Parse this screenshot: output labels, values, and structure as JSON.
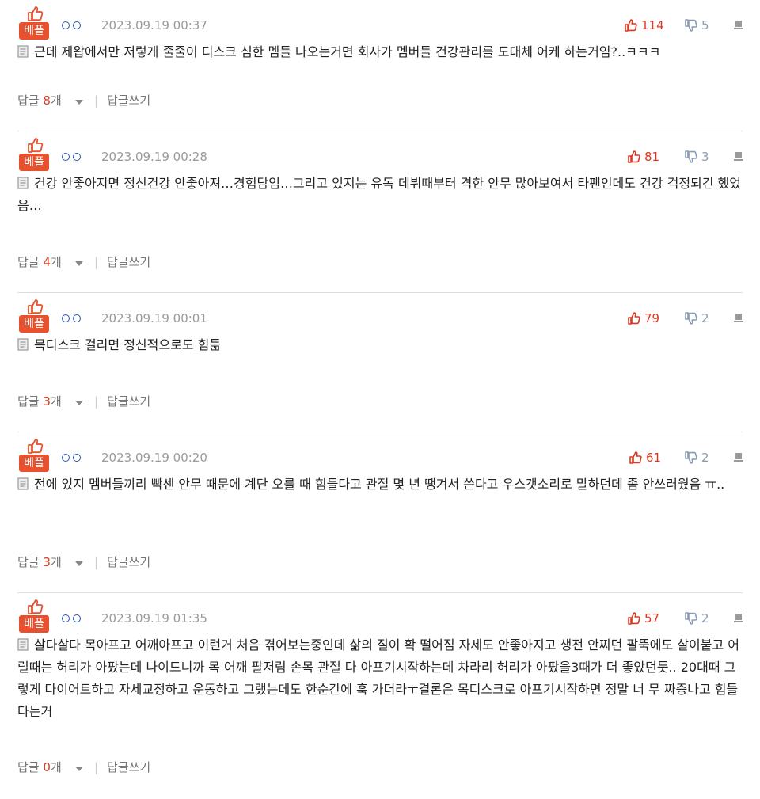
{
  "colors": {
    "best_badge": "#e8502e",
    "upvote": "#e0371f",
    "downvote": "#8a9bb3",
    "user_icon": "#2a55b8"
  },
  "labels": {
    "best_badge": "베플",
    "reply": "답글",
    "reply_unit": "개",
    "separator": "|",
    "write_reply": "답글쓰기"
  },
  "comments": [
    {
      "date": "2023.09.19 00:37",
      "likes": "114",
      "dislikes": "5",
      "text": "근데 제왑에서만 저렇게 줄줄이 디스크 심한 멤들 나오는거면 회사가 멤버들 건강관리를 도대체 어케 하는거임?..ㅋㅋㅋ",
      "replies": "8"
    },
    {
      "date": "2023.09.19 00:28",
      "likes": "81",
      "dislikes": "3",
      "text": "건강 안좋아지면 정신건강 안좋아져…경험담임…그리고 있지는 유독 데뷔때부터 격한 안무 많아보여서 타팬인데도 건강 걱정되긴 했었음…",
      "replies": "4"
    },
    {
      "date": "2023.09.19 00:01",
      "likes": "79",
      "dislikes": "2",
      "text": "목디스크 걸리면 정신적으로도 힘듦",
      "replies": "3"
    },
    {
      "date": "2023.09.19 00:20",
      "likes": "61",
      "dislikes": "2",
      "text": "전에 있지 멤버들끼리 빡센 안무 때문에 계단 오를 때 힘들다고 관절 몇 년 땡겨서 쓴다고 우스갯소리로 말하던데 좀 안쓰러웠음 ㅠ..",
      "replies": "3"
    },
    {
      "date": "2023.09.19 01:35",
      "likes": "57",
      "dislikes": "2",
      "text": "살다살다 목아프고 어깨아프고 이런거 처음 겪어보는중인데 삶의 질이 확 떨어짐 자세도 안좋아지고 생전 안찌던 팔뚝에도 살이붙고 어릴때는 허리가 아팠는데 나이드니까 목 어깨 팔저림 손목 관절 다 아프기시작하는데 차라리 허리가 아팠을3때가 더 좋았던듯.. 20대때 그렇게 다이어트하고 자세교정하고 운동하고 그랬는데도 한순간에 훅 가더라ㅜ결론은 목디스크로 아프기시작하면 정말 너 무 짜증나고 힘들다는거",
      "replies": "0"
    }
  ]
}
